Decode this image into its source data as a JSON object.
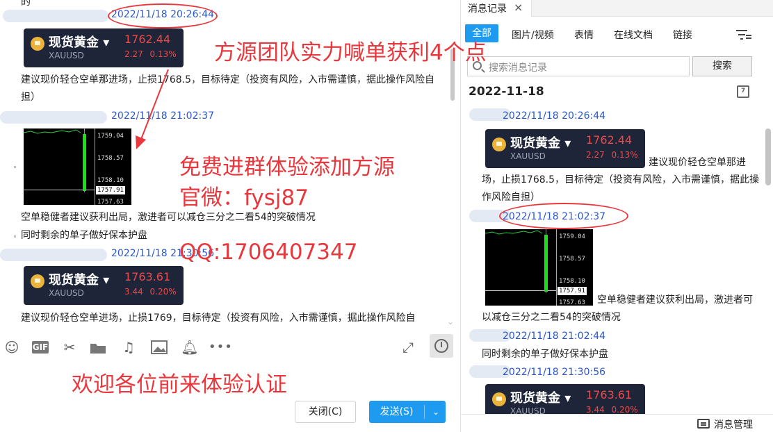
{
  "chat": {
    "top_cut_text": "的",
    "messages": [
      {
        "timestamp": "2022/11/18 20:26:44",
        "card": {
          "name": "现货黄金",
          "code": "XAUUSD",
          "price": "1762.44",
          "change": "2.27",
          "pct": "0.13%"
        },
        "text": "建议现价轻仓空单那进场，止损1768.5，目标待定（投资有风险，入市需谨慎，据此操作风险自担）"
      },
      {
        "timestamp": "2022/11/18 21:02:37",
        "chart": {
          "ticks": [
            "1759.04",
            "1758.57",
            "1758.10",
            "1757.63"
          ],
          "last": "1757.91"
        },
        "text1": "空单稳健者建议获利出局，激进者可以减仓三分之二看54的突破情况",
        "text2": "同时剩余的单子做好保本护盘"
      },
      {
        "timestamp": "2022/11/18 21:30:56",
        "card": {
          "name": "现货黄金",
          "code": "XAUUSD",
          "price": "1763.61",
          "change": "3.44",
          "pct": "0.20%"
        },
        "text": "建议现价轻仓空单进场，止损1769，目标待定（投资有风险，入市需谨慎，据此操作风险自"
      }
    ],
    "toolbar_icons": [
      "emoji-icon",
      "gif-icon",
      "scissors-icon",
      "folder-icon",
      "music-icon",
      "image-icon",
      "bell-icon",
      "more-icon",
      "expand-icon",
      "history-clock-icon"
    ],
    "gif_label": "GIF",
    "close_button": "关闭(C)",
    "send_button": "发送(S)",
    "send_dropdown": "⌄"
  },
  "history": {
    "tab_title": "消息记录",
    "tab_close": "×",
    "filters": [
      "全部",
      "图片/视频",
      "表情",
      "在线文档",
      "链接"
    ],
    "active_filter": "全部",
    "search_placeholder": "搜索消息记录",
    "search_button": "搜索",
    "date": "2022-11-18",
    "calendar_day": "7",
    "items": {
      "ts1": "2022/11/18 20:26:44",
      "card1": {
        "name": "现货黄金",
        "code": "XAUUSD",
        "price": "1762.44",
        "change": "2.27",
        "pct": "0.13%"
      },
      "text1": "建议现价轻仓空单那进场，止损1768.5，目标待定（投资有风险，入市需谨慎，据此操作风险自担）",
      "ts2": "2022/11/18 21:02:37",
      "chart": {
        "ticks": [
          "1759.04",
          "1758.57",
          "1758.10",
          "1757.63"
        ],
        "last": "1757.91"
      },
      "text2": "空单稳健者建议获利出局，激进者可以减仓三分之二看54的突破情况",
      "ts3": "2022/11/18 21:02:44",
      "text3": "同时剩余的单子做好保本护盘",
      "ts4": "2022/11/18 21:30:56",
      "card2": {
        "name": "现货黄金",
        "code": "XAUUSD",
        "price": "1763.61",
        "change": "3.44",
        "pct": "0.20%"
      }
    },
    "footer": "消息管理"
  },
  "overlays": {
    "headline": "方源团队实力喊单获利4个点",
    "free": "免费进群体验添加方源",
    "wechat": "官微：fysj87",
    "qq": "QQ:1706407347",
    "welcome": "欢迎各位前来体验认证",
    "color": "#e8383d"
  }
}
